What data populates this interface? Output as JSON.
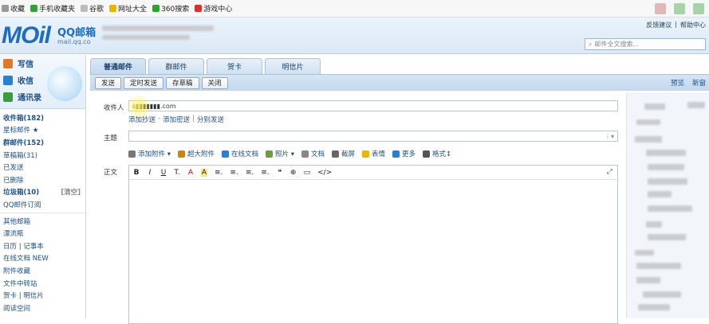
{
  "bookmarks": [
    {
      "label": "收藏",
      "color": "#999999"
    },
    {
      "label": "手机收藏夹",
      "color": "#3a9b3a"
    },
    {
      "label": "谷歌",
      "color": "#bbbbbb"
    },
    {
      "label": "网址大全",
      "color": "#e8b400"
    },
    {
      "label": "360搜索",
      "color": "#2aa52a"
    },
    {
      "label": "游戏中心",
      "color": "#d33333"
    }
  ],
  "header": {
    "logo": "MOil",
    "logo_cn": "QQ邮箱",
    "logo_url": "mail.qq.co",
    "toplinks": [
      "反馈建议",
      "|",
      "帮助中心"
    ],
    "search_placeholder": "邮件全文搜索..."
  },
  "sidebar": {
    "actions": [
      {
        "label": "写信",
        "icon": "pencil-icon",
        "color": "#e07a28"
      },
      {
        "label": "收信",
        "icon": "inbox-icon",
        "color": "#2a7fd0"
      },
      {
        "label": "通讯录",
        "icon": "contacts-icon",
        "color": "#3a9b3a"
      }
    ],
    "folders": [
      {
        "label": "收件箱(182)",
        "bold": true
      },
      {
        "label": "星标邮件 ★",
        "bold": false
      },
      {
        "label": "群邮件(152)",
        "bold": true
      },
      {
        "label": "草稿箱(31)",
        "bold": false
      },
      {
        "label": "已发送",
        "bold": false
      },
      {
        "label": "已删除",
        "bold": false
      },
      {
        "label": "垃圾箱(10)",
        "bold": true,
        "extra": "[清空]"
      },
      {
        "label": "QQ邮件订阅",
        "bold": false
      }
    ],
    "others": [
      {
        "label": "其他邮箱"
      },
      {
        "label": "漂流瓶"
      },
      {
        "label": "日历 | 记事本"
      },
      {
        "label": "在线文档 NEW"
      },
      {
        "label": "附件收藏"
      },
      {
        "label": "文件中转站"
      },
      {
        "label": "贺卡 | 明信片"
      },
      {
        "label": "阅读空间"
      }
    ]
  },
  "tabs": [
    "普通邮件",
    "群邮件",
    "贺卡",
    "明信片"
  ],
  "toolbar": {
    "buttons": [
      "发送",
      "定时发送",
      "存草稿",
      "关闭"
    ],
    "right": [
      "预览",
      "新窗"
    ]
  },
  "compose": {
    "to_label": "收件人",
    "to_value": "s▮▮▮▮▮▮▮.com",
    "cc_links": [
      "添加抄送",
      "-",
      "添加密送",
      "|",
      "分别发送"
    ],
    "subject_label": "主题",
    "subject_value": "",
    "attach_opts": [
      {
        "label": "添加附件 ▾",
        "icon": "paperclip-icon",
        "color": "#777777"
      },
      {
        "label": "超大附件",
        "icon": "big-attachment-icon",
        "color": "#cc8800"
      },
      {
        "label": "在线文档",
        "icon": "doc-online-icon",
        "color": "#2a7fd0"
      },
      {
        "label": "照片 ▾",
        "icon": "photo-icon",
        "color": "#6a9f3a"
      },
      {
        "label": "文档",
        "icon": "document-icon",
        "color": "#888888"
      },
      {
        "label": "截屏",
        "icon": "screenshot-icon",
        "color": "#666666"
      },
      {
        "label": "表情",
        "icon": "emoji-icon",
        "color": "#e6b800"
      },
      {
        "label": "更多",
        "icon": "more-icon",
        "color": "#2a7fd0"
      },
      {
        "label": "格式↕",
        "icon": "format-icon",
        "color": "#555555"
      }
    ],
    "body_label": "正文",
    "editor_tools": [
      "B",
      "I",
      "U",
      "T.",
      "A",
      "A",
      "≡.",
      "≡.",
      "≡.",
      "≡.",
      "❝",
      "⊕",
      "▭",
      "</>"
    ]
  }
}
